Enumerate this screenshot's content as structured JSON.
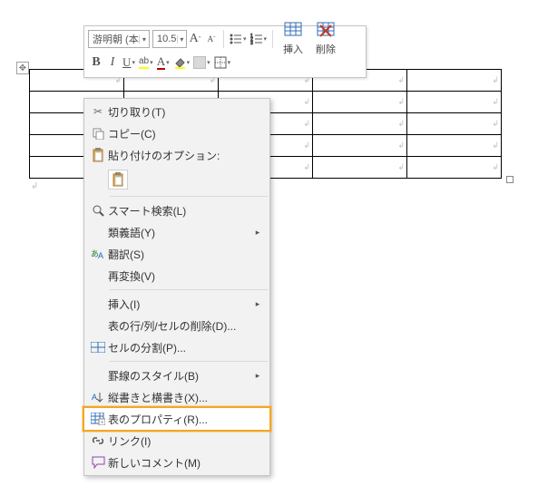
{
  "toolbar": {
    "font_name": "游明朝 (本",
    "font_size": "10.5",
    "btn_bold": "B",
    "btn_italic": "I",
    "btn_underline": "U",
    "btn_font_color": "A",
    "btn_highlight": "ab",
    "insert_label": "挿入",
    "delete_label": "削除"
  },
  "context_menu": {
    "cut": "切り取り(T)",
    "copy": "コピー(C)",
    "paste_options": "貼り付けのオプション:",
    "smart_lookup": "スマート検索(L)",
    "synonyms": "類義語(Y)",
    "translate": "翻訳(S)",
    "reconvert": "再変換(V)",
    "insert": "挿入(I)",
    "delete_rcc": "表の行/列/セルの削除(D)...",
    "split_cells": "セルの分割(P)...",
    "border_style": "罫線のスタイル(B)",
    "text_direction": "縦書きと横書き(X)...",
    "table_properties": "表のプロパティ(R)...",
    "link": "リンク(I)",
    "new_comment": "新しいコメント(M)"
  }
}
